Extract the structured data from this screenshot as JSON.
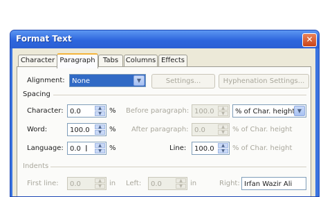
{
  "dialog": {
    "title": "Format Text",
    "close_glyph": "✕",
    "tabs": [
      {
        "label": "Character",
        "active": false
      },
      {
        "label": "Paragraph",
        "active": true
      },
      {
        "label": "Tabs",
        "active": false
      },
      {
        "label": "Columns",
        "active": false
      },
      {
        "label": "Effects",
        "active": false
      }
    ],
    "alignment": {
      "label": "Alignment:",
      "value": "None",
      "settings_button": "Settings...",
      "hyphenation_button": "Hyphenation Settings..."
    },
    "spacing": {
      "section_label": "Spacing",
      "character": {
        "label": "Character:",
        "value": "0.0",
        "unit": "%"
      },
      "word": {
        "label": "Word:",
        "value": "100.0",
        "unit": "%"
      },
      "language": {
        "label": "Language:",
        "value": "0.0",
        "unit": "%"
      },
      "before_paragraph": {
        "label": "Before paragraph:",
        "value": "100.0",
        "unit_select": "% of Char. height"
      },
      "after_paragraph": {
        "label": "After paragraph:",
        "value": "0.0",
        "unit": "% of Char. height"
      },
      "line": {
        "label": "Line:",
        "value": "100.0",
        "unit": "% of Char. height"
      }
    },
    "indents": {
      "section_label": "Indents",
      "first_line": {
        "label": "First line:",
        "value": "0.0",
        "unit": "in"
      },
      "left": {
        "label": "Left:",
        "value": "0.0",
        "unit": "in"
      },
      "right": {
        "label": "Right:",
        "value": "Irfan Wazir Ali"
      }
    }
  },
  "colors": {
    "title_bar": "#2e66dd",
    "dialog_face": "#ece9d8",
    "selection": "#316ac5",
    "close_button": "#c94418"
  }
}
